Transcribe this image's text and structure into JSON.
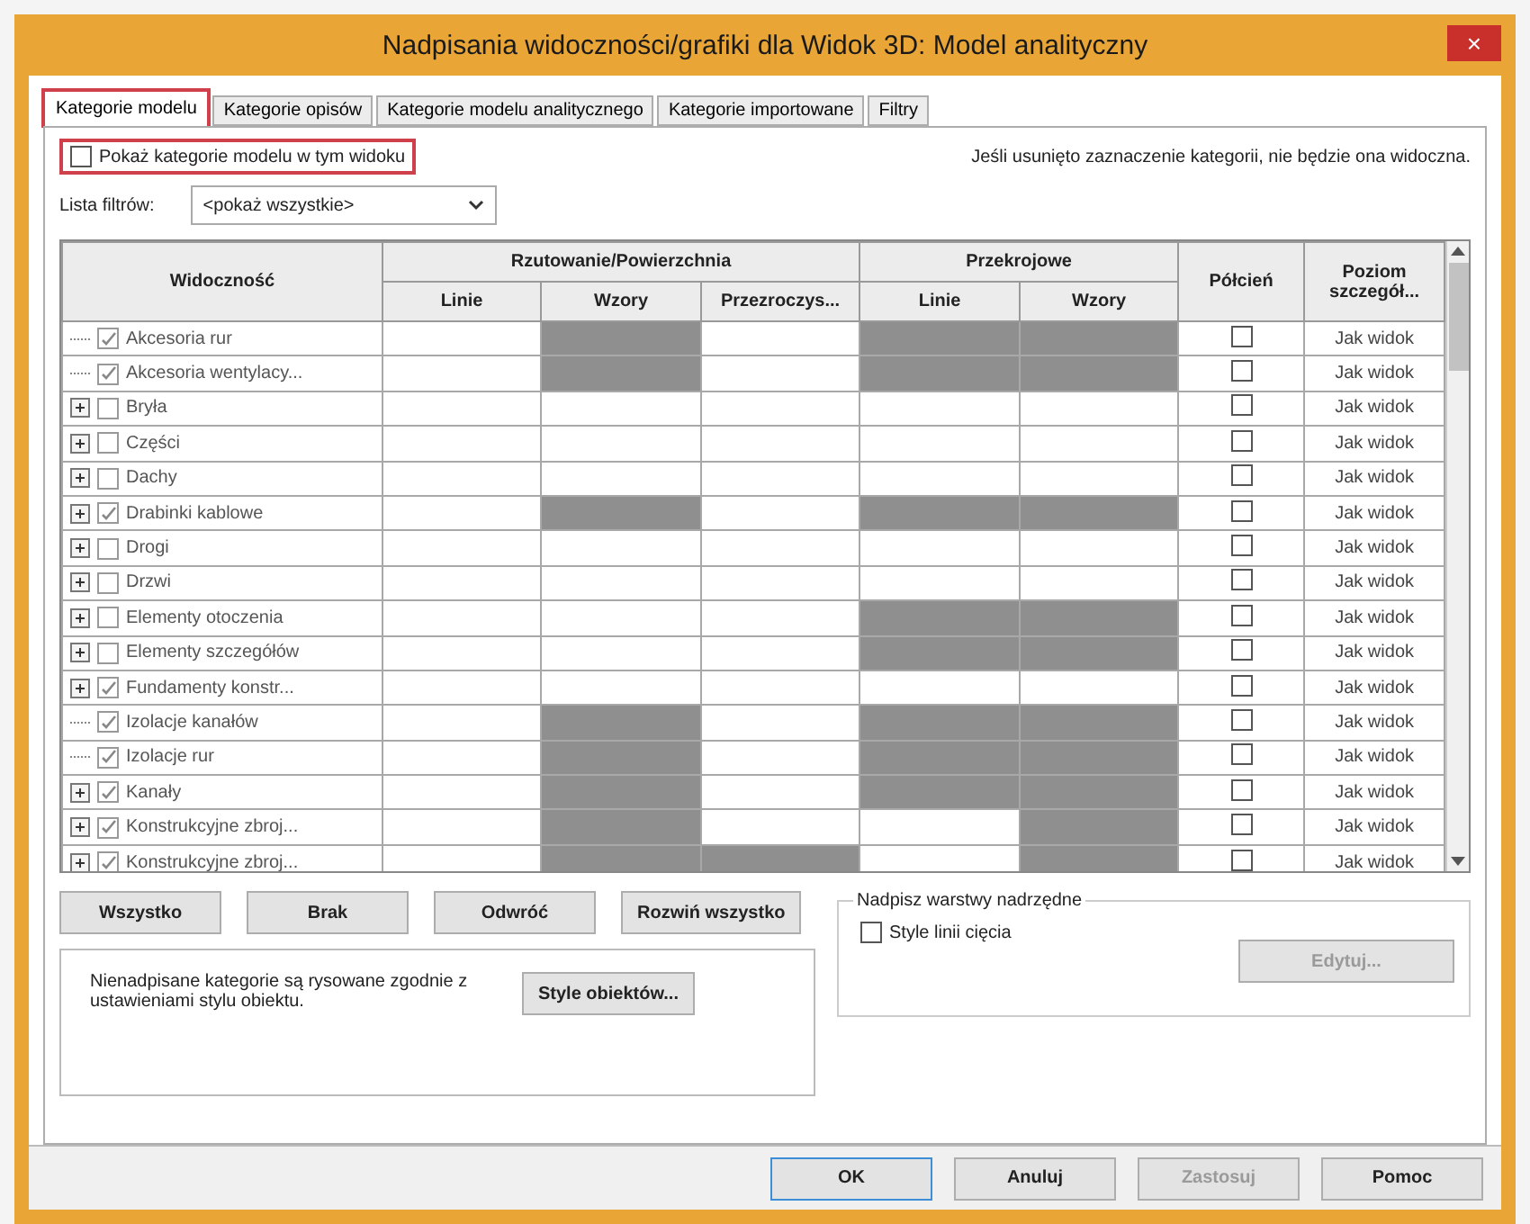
{
  "window": {
    "title": "Nadpisania widoczności/grafiki dla Widok 3D: Model analityczny",
    "close": "×"
  },
  "tabs": [
    {
      "label": "Kategorie modelu",
      "selected": true,
      "highlighted": true
    },
    {
      "label": "Kategorie opisów",
      "selected": false,
      "highlighted": false
    },
    {
      "label": "Kategorie modelu analitycznego",
      "selected": false,
      "highlighted": false
    },
    {
      "label": "Kategorie importowane",
      "selected": false,
      "highlighted": false
    },
    {
      "label": "Filtry",
      "selected": false,
      "highlighted": false
    }
  ],
  "show_categories": {
    "label": "Pokaż kategorie modelu w tym widoku",
    "checked": false,
    "highlighted": true
  },
  "note": "Jeśli usunięto zaznaczenie kategorii, nie będzie ona widoczna.",
  "filter": {
    "label": "Lista filtrów:",
    "value": "<pokaż wszystkie>"
  },
  "table": {
    "visibility_header": "Widoczność",
    "groups": [
      {
        "label": "Rzutowanie/Powierzchnia",
        "columns": [
          "Linie",
          "Wzory",
          "Przezroczys..."
        ]
      },
      {
        "label": "Przekrojowe",
        "columns": [
          "Linie",
          "Wzory"
        ]
      }
    ],
    "halftone_header": "Półcień",
    "detail_header": "Poziom szczegół...",
    "rows": [
      {
        "name": "Akcesoria rur",
        "checked": true,
        "expandable": false,
        "cells": [
          {
            "disabled": false
          },
          {
            "disabled": true
          },
          {
            "disabled": false
          },
          {
            "disabled": true
          },
          {
            "disabled": true
          }
        ],
        "halftone": false,
        "detail": "Jak widok"
      },
      {
        "name": "Akcesoria wentylacy...",
        "checked": true,
        "expandable": false,
        "cells": [
          {
            "disabled": false
          },
          {
            "disabled": true
          },
          {
            "disabled": false
          },
          {
            "disabled": true
          },
          {
            "disabled": true
          }
        ],
        "halftone": false,
        "detail": "Jak widok"
      },
      {
        "name": "Bryła",
        "checked": false,
        "expandable": true,
        "cells": [
          {
            "disabled": false
          },
          {
            "disabled": false
          },
          {
            "disabled": false
          },
          {
            "disabled": false
          },
          {
            "disabled": false
          }
        ],
        "halftone": false,
        "detail": "Jak widok"
      },
      {
        "name": "Części",
        "checked": false,
        "expandable": true,
        "cells": [
          {
            "disabled": false
          },
          {
            "disabled": false
          },
          {
            "disabled": false
          },
          {
            "disabled": false
          },
          {
            "disabled": false
          }
        ],
        "halftone": false,
        "detail": "Jak widok"
      },
      {
        "name": "Dachy",
        "checked": false,
        "expandable": true,
        "cells": [
          {
            "disabled": false
          },
          {
            "disabled": false
          },
          {
            "disabled": false
          },
          {
            "disabled": false
          },
          {
            "disabled": false
          }
        ],
        "halftone": false,
        "detail": "Jak widok"
      },
      {
        "name": "Drabinki kablowe",
        "checked": true,
        "expandable": true,
        "cells": [
          {
            "disabled": false
          },
          {
            "disabled": true
          },
          {
            "disabled": false
          },
          {
            "disabled": true
          },
          {
            "disabled": true
          }
        ],
        "halftone": false,
        "detail": "Jak widok"
      },
      {
        "name": "Drogi",
        "checked": false,
        "expandable": true,
        "cells": [
          {
            "disabled": false
          },
          {
            "disabled": false
          },
          {
            "disabled": false
          },
          {
            "disabled": false
          },
          {
            "disabled": false
          }
        ],
        "halftone": false,
        "detail": "Jak widok"
      },
      {
        "name": "Drzwi",
        "checked": false,
        "expandable": true,
        "cells": [
          {
            "disabled": false
          },
          {
            "disabled": false
          },
          {
            "disabled": false
          },
          {
            "disabled": false
          },
          {
            "disabled": false
          }
        ],
        "halftone": false,
        "detail": "Jak widok"
      },
      {
        "name": "Elementy otoczenia",
        "checked": false,
        "expandable": true,
        "cells": [
          {
            "disabled": false
          },
          {
            "disabled": false
          },
          {
            "disabled": false
          },
          {
            "disabled": true
          },
          {
            "disabled": true
          }
        ],
        "halftone": false,
        "detail": "Jak widok"
      },
      {
        "name": "Elementy szczegółów",
        "checked": false,
        "expandable": true,
        "cells": [
          {
            "disabled": false
          },
          {
            "disabled": false
          },
          {
            "disabled": false
          },
          {
            "disabled": true
          },
          {
            "disabled": true
          }
        ],
        "halftone": false,
        "detail": "Jak widok"
      },
      {
        "name": "Fundamenty konstr...",
        "checked": true,
        "expandable": true,
        "cells": [
          {
            "disabled": false
          },
          {
            "disabled": false
          },
          {
            "disabled": false
          },
          {
            "disabled": false
          },
          {
            "disabled": false
          }
        ],
        "halftone": false,
        "detail": "Jak widok"
      },
      {
        "name": "Izolacje kanałów",
        "checked": true,
        "expandable": false,
        "cells": [
          {
            "disabled": false
          },
          {
            "disabled": true
          },
          {
            "disabled": false
          },
          {
            "disabled": true
          },
          {
            "disabled": true
          }
        ],
        "halftone": false,
        "detail": "Jak widok"
      },
      {
        "name": "Izolacje rur",
        "checked": true,
        "expandable": false,
        "cells": [
          {
            "disabled": false
          },
          {
            "disabled": true
          },
          {
            "disabled": false
          },
          {
            "disabled": true
          },
          {
            "disabled": true
          }
        ],
        "halftone": false,
        "detail": "Jak widok"
      },
      {
        "name": "Kanały",
        "checked": true,
        "expandable": true,
        "cells": [
          {
            "disabled": false
          },
          {
            "disabled": true
          },
          {
            "disabled": false
          },
          {
            "disabled": true
          },
          {
            "disabled": true
          }
        ],
        "halftone": false,
        "detail": "Jak widok"
      },
      {
        "name": "Konstrukcyjne zbroj...",
        "checked": true,
        "expandable": true,
        "cells": [
          {
            "disabled": false
          },
          {
            "disabled": true
          },
          {
            "disabled": false
          },
          {
            "disabled": false
          },
          {
            "disabled": true
          }
        ],
        "halftone": false,
        "detail": "Jak widok"
      },
      {
        "name": "Konstrukcyjne zbroj...",
        "checked": true,
        "expandable": true,
        "cells": [
          {
            "disabled": false
          },
          {
            "disabled": true
          },
          {
            "disabled": true
          },
          {
            "disabled": false
          },
          {
            "disabled": true
          }
        ],
        "halftone": false,
        "detail": "Jak widok"
      }
    ]
  },
  "selection_buttons": [
    "Wszystko",
    "Brak",
    "Odwróć",
    "Rozwiń wszystko"
  ],
  "object_styles": {
    "text": "Nienadpisane kategorie są rysowane zgodnie z ustawieniami stylu obiektu.",
    "button": "Style obiektów..."
  },
  "host_layers": {
    "title": "Nadpisz warstwy nadrzędne",
    "checkbox": {
      "label": "Style linii cięcia",
      "checked": false
    },
    "button": {
      "label": "Edytuj...",
      "disabled": true
    }
  },
  "footer_buttons": [
    {
      "label": "OK",
      "disabled": false,
      "default": true
    },
    {
      "label": "Anuluj",
      "disabled": false,
      "default": false
    },
    {
      "label": "Zastosuj",
      "disabled": true,
      "default": false
    },
    {
      "label": "Pomoc",
      "disabled": false,
      "default": false
    }
  ]
}
